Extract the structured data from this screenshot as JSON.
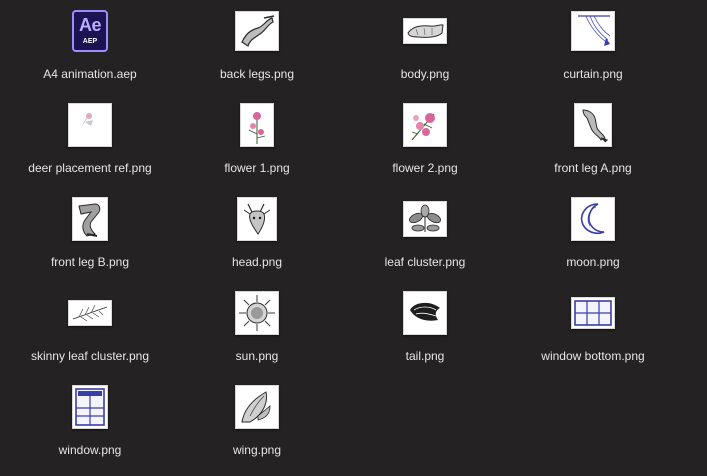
{
  "files": [
    {
      "name": "A4 animation.aep",
      "icon": "after-effects-project-icon",
      "badge": "Ae",
      "badge_type": "AEP"
    },
    {
      "name": "back legs.png",
      "icon": "back-legs-thumbnail-icon"
    },
    {
      "name": "body.png",
      "icon": "body-thumbnail-icon"
    },
    {
      "name": "curtain.png",
      "icon": "curtain-thumbnail-icon"
    },
    {
      "name": "deer placement ref.png",
      "icon": "deer-placement-thumbnail-icon"
    },
    {
      "name": "flower 1.png",
      "icon": "flower-thumbnail-icon"
    },
    {
      "name": "flower 2.png",
      "icon": "flower-thumbnail-icon"
    },
    {
      "name": "front leg A.png",
      "icon": "front-leg-thumbnail-icon"
    },
    {
      "name": "front leg B.png",
      "icon": "front-leg-thumbnail-icon"
    },
    {
      "name": "head.png",
      "icon": "head-thumbnail-icon"
    },
    {
      "name": "leaf cluster.png",
      "icon": "leaf-cluster-thumbnail-icon"
    },
    {
      "name": "moon.png",
      "icon": "moon-thumbnail-icon"
    },
    {
      "name": "skinny leaf cluster.png",
      "icon": "skinny-leaf-thumbnail-icon"
    },
    {
      "name": "sun.png",
      "icon": "sun-thumbnail-icon"
    },
    {
      "name": "tail.png",
      "icon": "tail-thumbnail-icon"
    },
    {
      "name": "window bottom.png",
      "icon": "window-bottom-thumbnail-icon"
    },
    {
      "name": "window.png",
      "icon": "window-thumbnail-icon"
    },
    {
      "name": "wing.png",
      "icon": "wing-thumbnail-icon"
    }
  ],
  "colors": {
    "background": "#252223",
    "label_text": "#e6e6e6",
    "ae_purple": "#9d8cff",
    "ae_dark": "#1c1352",
    "ink": "#2a2a2a",
    "blue_ink": "#3a3ea8",
    "pink": "#d9659a"
  }
}
